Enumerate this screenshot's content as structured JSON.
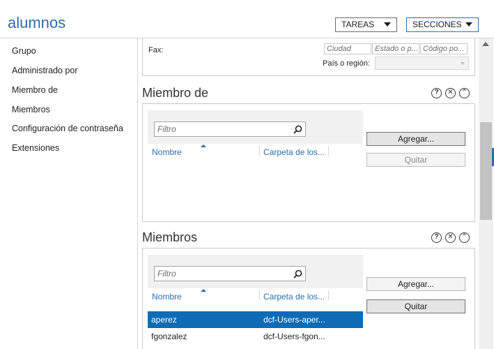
{
  "header": {
    "title": "alumnos",
    "tasks_button": "TAREAS",
    "sections_button": "SECCIONES"
  },
  "sidebar": {
    "items": [
      {
        "label": "Grupo"
      },
      {
        "label": "Administrado por"
      },
      {
        "label": "Miembro de"
      },
      {
        "label": "Miembros"
      },
      {
        "label": "Configuración de contraseña"
      },
      {
        "label": "Extensiones"
      }
    ]
  },
  "fax_section": {
    "fax_label": "Fax:",
    "city_placeholder": "Ciudad",
    "state_placeholder": "Estado o p...",
    "zip_placeholder": "Código po...",
    "region_label": "País o región:",
    "region_value": ""
  },
  "member_of": {
    "title": "Miembro de",
    "icons": {
      "help": "?",
      "close": "✕",
      "collapse": "⌃"
    },
    "filter_placeholder": "Filtro",
    "columns": [
      "Nombre",
      "Carpeta de los..."
    ],
    "add_label": "Agregar...",
    "remove_label": "Quitar",
    "rows": []
  },
  "members": {
    "title": "Miembros",
    "icons": {
      "help": "?",
      "close": "✕",
      "collapse": "⌃"
    },
    "filter_placeholder": "Filtro",
    "columns": [
      "Nombre",
      "Carpeta de los..."
    ],
    "add_label": "Agregar...",
    "remove_label": "Quitar",
    "rows": [
      {
        "name": "aperez",
        "folder": "dcf-Users-aper...",
        "selected": true
      },
      {
        "name": "fgonzalez",
        "folder": "dcf-Users-fgon...",
        "selected": false
      }
    ]
  },
  "colors": {
    "accent": "#2a6db0",
    "selection": "#0f6bb5"
  }
}
